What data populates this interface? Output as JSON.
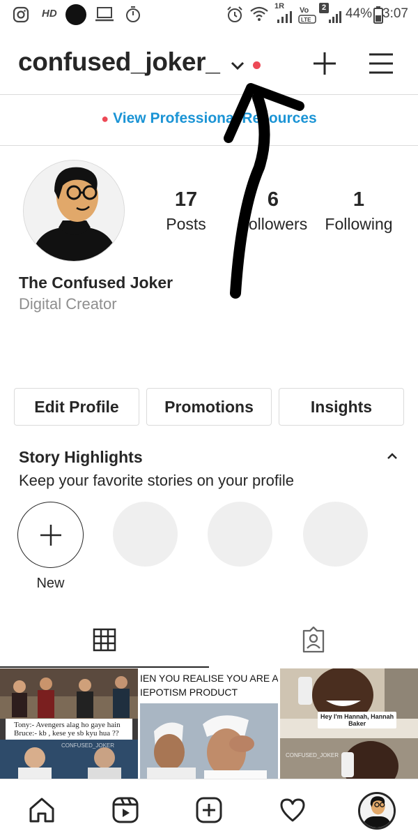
{
  "status_bar": {
    "hd": "HD",
    "signal_label": "1R",
    "sim_badge": "2",
    "volte": "VoLTE",
    "battery": "44%",
    "time": "3:07"
  },
  "header": {
    "username": "confused_joker_",
    "icons": [
      "chevron-down-icon",
      "notification-dot",
      "new-post-icon",
      "menu-icon"
    ]
  },
  "professional_link": "View Professional Resources",
  "profile": {
    "full_name": "The Confused Joker",
    "category": "Digital Creator",
    "stats": [
      {
        "value": "17",
        "label": "Posts"
      },
      {
        "value": "6",
        "label": "Followers"
      },
      {
        "value": "1",
        "label": "Following"
      }
    ]
  },
  "buttons": {
    "edit_profile": "Edit Profile",
    "promotions": "Promotions",
    "insights": "Insights"
  },
  "highlights": {
    "title": "Story Highlights",
    "subtitle": "Keep your favorite stories on your profile",
    "new_label": "New"
  },
  "grid_posts": [
    {
      "caption_lines": [
        "Tony:- Avengers alag ho gaye hain",
        "Bruce:- kb , kese ye sb kyu hua ??"
      ],
      "watermark": "CONFUSED_JOKER"
    },
    {
      "caption_lines": [
        "IEN YOU REALISE YOU ARE ALS",
        "IEPOTISM PRODUCT"
      ]
    },
    {
      "caption_lines": [
        "Hey I'm Hannah, Hannah",
        "Baker"
      ],
      "watermark": "CONFUSED_JOKER"
    }
  ],
  "bottom_nav": [
    "home-icon",
    "reels-icon",
    "new-post-icon",
    "activity-heart-icon",
    "profile-avatar"
  ],
  "colors": {
    "link_blue": "#1b94d5",
    "notification_red": "#ed4956",
    "text_dark": "#262626",
    "text_muted": "#8e8e8e",
    "divider": "#dbdbdb"
  }
}
